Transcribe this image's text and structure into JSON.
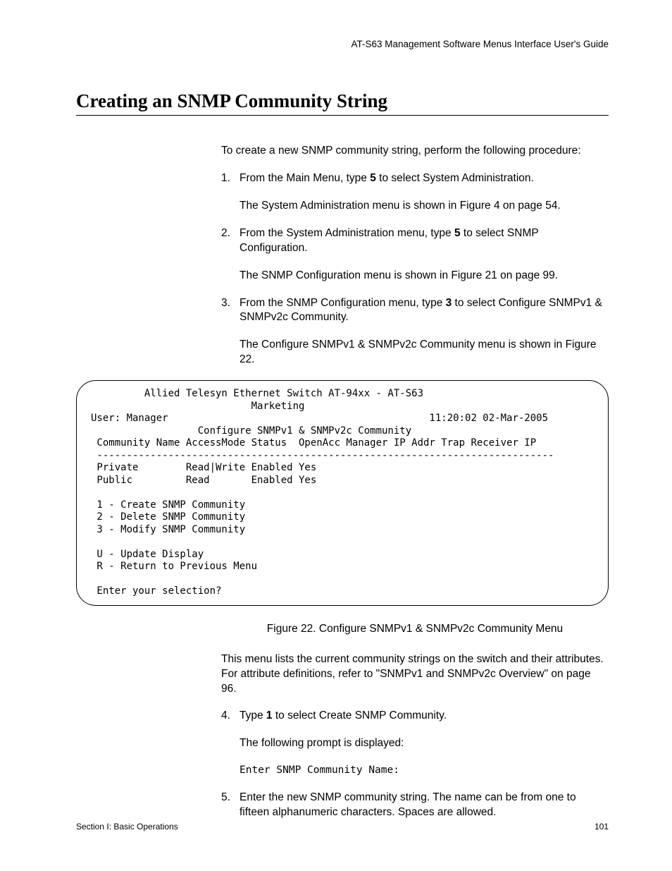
{
  "header": {
    "guide_title": "AT-S63 Management Software Menus Interface User's Guide"
  },
  "section": {
    "title": "Creating an SNMP Community String"
  },
  "body": {
    "intro": "To create a new SNMP community string, perform the following procedure:",
    "step1_pre": "From the Main Menu, type ",
    "step1_key": "5",
    "step1_post": " to select System Administration.",
    "step1_note": "The System Administration menu is shown in Figure 4 on page 54.",
    "step2_pre": "From the System Administration menu, type ",
    "step2_key": "5",
    "step2_post": " to select SNMP Configuration.",
    "step2_note": "The SNMP Configuration menu is shown in Figure 21 on page 99.",
    "step3_pre": "From the SNMP Configuration menu, type ",
    "step3_key": "3",
    "step3_post": " to select Configure SNMPv1 & SNMPv2c Community.",
    "step3_note": "The Configure SNMPv1 & SNMPv2c Community menu is shown in Figure 22.",
    "fig_caption": "Figure 22. Configure SNMPv1 & SNMPv2c Community Menu",
    "after_fig": "This menu lists the current community strings on the switch and their attributes. For attribute definitions, refer to \"SNMPv1 and SNMPv2c Overview\" on page 96.",
    "step4_pre": "Type ",
    "step4_key": "1",
    "step4_post": " to select Create SNMP Community.",
    "step4_note": "The following prompt is displayed:",
    "step4_prompt": "Enter SNMP Community Name:",
    "step5": "Enter the new SNMP community string. The name can be from one to fifteen alphanumeric characters. Spaces are allowed."
  },
  "terminal": {
    "line1": "         Allied Telesyn Ethernet Switch AT-94xx - AT-S63",
    "line2": "                           Marketing",
    "line3": "User: Manager                                            11:20:02 02-Mar-2005",
    "line4": "                  Configure SNMPv1 & SNMPv2c Community",
    "line5": " Community Name AccessMode Status  OpenAcc Manager IP Addr Trap Receiver IP",
    "line6": " -----------------------------------------------------------------------------",
    "line7": " Private        Read|Write Enabled Yes",
    "line8": " Public         Read       Enabled Yes",
    "line9": "",
    "line10": " 1 - Create SNMP Community",
    "line11": " 2 - Delete SNMP Community",
    "line12": " 3 - Modify SNMP Community",
    "line13": "",
    "line14": " U - Update Display",
    "line15": " R - Return to Previous Menu",
    "line16": "",
    "line17": " Enter your selection?"
  },
  "footer": {
    "left": "Section I: Basic Operations",
    "right": "101"
  },
  "nums": {
    "n1": "1.",
    "n2": "2.",
    "n3": "3.",
    "n4": "4.",
    "n5": "5."
  }
}
